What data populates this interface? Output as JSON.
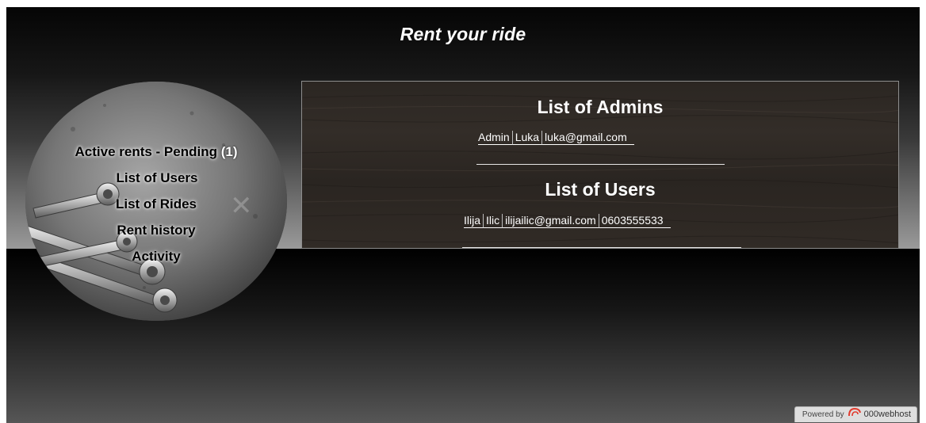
{
  "header": {
    "title": "Rent your ride"
  },
  "nav": {
    "items": [
      {
        "label": "Active rents - Pending",
        "count": "(1)"
      },
      {
        "label": "List of Users"
      },
      {
        "label": "List of Rides"
      },
      {
        "label": "Rent history"
      },
      {
        "label": "Activity"
      }
    ]
  },
  "admins": {
    "title": "List of Admins",
    "rows": [
      [
        "Admin",
        "Luka",
        "luka@gmail.com"
      ]
    ]
  },
  "users": {
    "title": "List of Users",
    "rows": [
      [
        "Ilija",
        "Ilic",
        "ilijailic@gmail.com",
        "0603555533"
      ]
    ]
  },
  "footer": {
    "powered_label": "Powered by",
    "brand": "000webhost"
  },
  "colors": {
    "title_text": "#ffffff",
    "nav_text": "#000000",
    "panel_border": "#8d8d8d"
  },
  "icons": {
    "brand_logo": "000webhost-logo-icon",
    "decor": "wrench-icon"
  }
}
